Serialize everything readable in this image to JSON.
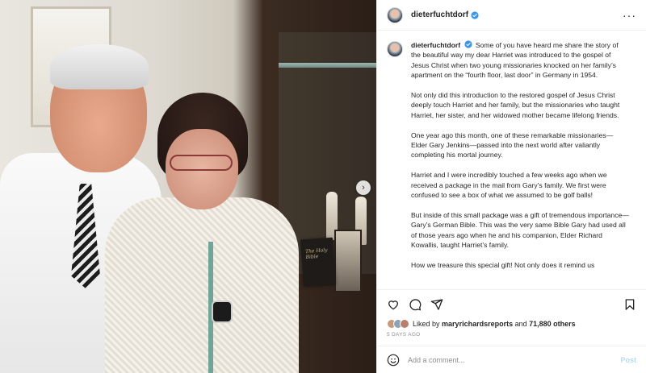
{
  "header": {
    "username": "dieterfuchtdorf"
  },
  "photo": {
    "book_title": "The Holy Bible",
    "next_glyph": "›"
  },
  "caption": {
    "author": "dieterfuchtdorf",
    "paragraphs": [
      "Some of you have heard me share the story of the beautiful way my dear Harriet was introduced to the gospel of Jesus Christ when two young missionaries knocked on her family’s apartment on the “fourth floor, last door” in Germany in 1954.",
      "Not only did this introduction to the restored gospel of Jesus Christ deeply touch Harriet and her family, but the missionaries who taught Harriet, her sister, and her widowed mother became lifelong friends.",
      "One year ago this month, one of these remarkable missionaries—Elder Gary Jenkins—passed into the next world after valiantly completing his mortal journey.",
      "Harriet and I were incredibly touched a few weeks ago when we received a package in the mail from Gary’s family. We first were confused to see a box of what we assumed to be golf balls!",
      "But inside of this small package was a gift of tremendous importance—Gary’s German Bible. This was the very same Bible Gary had used all of those years ago when he and his companion, Elder Richard Kowallis, taught Harriet’s family.",
      "How we treasure this special gift! Not only does it remind us"
    ]
  },
  "likes": {
    "prefix": "Liked by",
    "user": "maryrichardsreports",
    "middle": "and",
    "count": "71,880 others"
  },
  "time_ago": "5 DAYS AGO",
  "comment": {
    "placeholder": "Add a comment...",
    "post_label": "Post"
  },
  "colors": {
    "verified": "#3897f0",
    "post_button": "#b3dbff",
    "muted": "#8e8e8e"
  },
  "icons": [
    "heart-icon",
    "comment-icon",
    "share-icon",
    "bookmark-icon",
    "emoji-icon",
    "more-icon",
    "verified-icon"
  ]
}
